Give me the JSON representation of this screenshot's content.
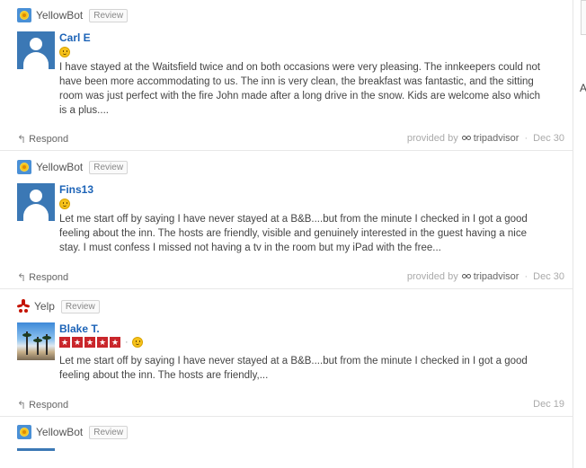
{
  "reviews": [
    {
      "source": "YellowBot",
      "badge": "Review",
      "author": "Carl E",
      "text": "I have stayed at the Waitsfield twice and on both occasions were very pleasing. The innkeepers could not have been more accommodating to us. The inn is very clean, the breakfast was fantastic, and the sitting room was just perfect with the fire John made after a long drive in the snow. Kids are welcome also which is a plus....",
      "respond": "Respond",
      "provided_by": "provided by",
      "provider": "tripadvisor",
      "date": "Dec 30"
    },
    {
      "source": "YellowBot",
      "badge": "Review",
      "author": "Fins13",
      "text": "Let me start off by saying I have never stayed at a B&B....but from the minute I checked in I got a good feeling about the inn. The hosts are friendly, visible and genuinely interested in the guest having a nice stay. I must confess I missed not having a tv in the room but my iPad with the free...",
      "respond": "Respond",
      "provided_by": "provided by",
      "provider": "tripadvisor",
      "date": "Dec 30"
    },
    {
      "source": "Yelp",
      "badge": "Review",
      "author": "Blake T.",
      "rating": 5,
      "rating_max": 5,
      "rating_sep": "·",
      "text": "Let me start off by saying I have never stayed at a B&B....but from the minute I checked in I got a good feeling about the inn. The hosts are friendly,...",
      "respond": "Respond",
      "date": "Dec 19"
    },
    {
      "source": "YellowBot",
      "badge": "Review"
    }
  ],
  "separator": "·",
  "side_letter": "A",
  "colors": {
    "link": "#1c63b7",
    "yelp_red": "#c9262b",
    "avatar_blue": "#3b78b5"
  },
  "icons": {
    "yellowbot": "yellowbot-logo-icon",
    "yelp": "yelp-logo-icon",
    "respond": "reply-arrow-icon",
    "tripadvisor": "tripadvisor-owl-icon",
    "sentiment": "smiley-icon"
  }
}
